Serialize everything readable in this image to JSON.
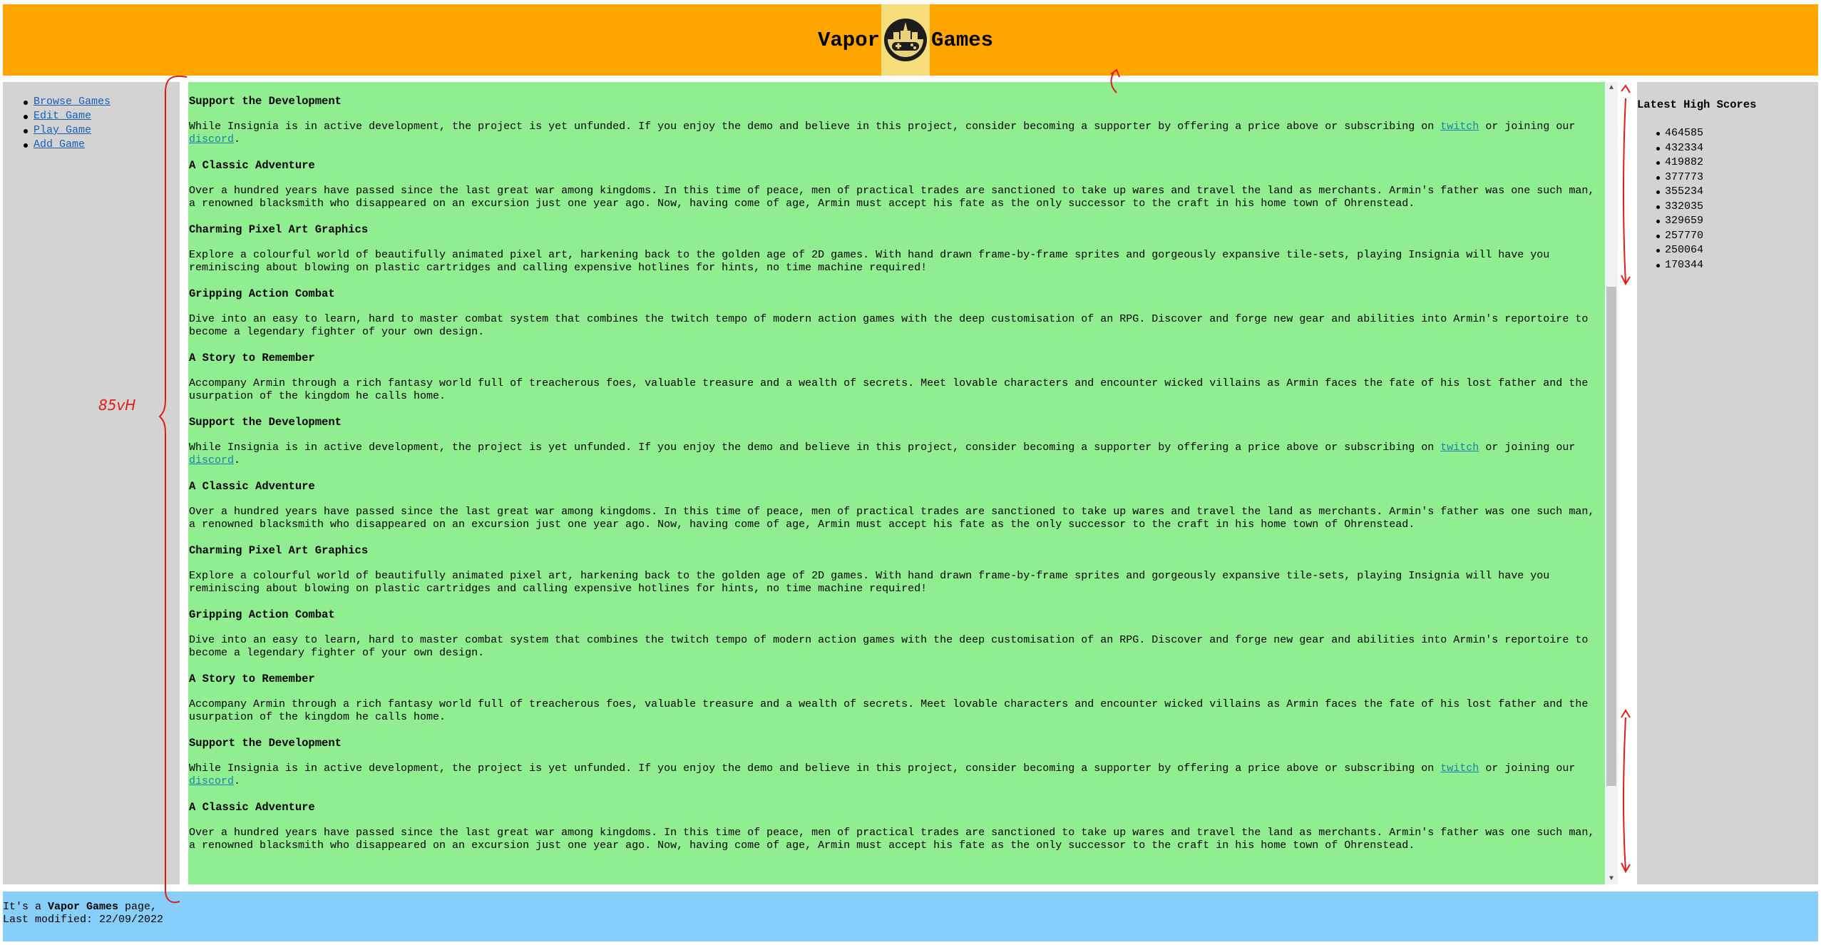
{
  "header": {
    "brand_left": "Vapor",
    "brand_right": "Games",
    "logo_icon": "gamepad-castle-logo-icon"
  },
  "nav": {
    "items": [
      {
        "label": "Browse Games"
      },
      {
        "label": "Edit Game"
      },
      {
        "label": "Play Game"
      },
      {
        "label": "Add Game"
      }
    ]
  },
  "main": {
    "sections": [
      {
        "title": "Support the Development",
        "text_before": "While Insignia is in active development, the project is yet unfunded. If you enjoy the demo and believe in this project, consider becoming a supporter by offering a price above or subscribing on ",
        "link1": "twitch",
        "text_mid": " or joining our ",
        "link2": "discord",
        "text_after": "."
      },
      {
        "title": "A Classic Adventure",
        "text": "Over a hundred years have passed since the last great war among kingdoms. In this time of peace, men of practical trades are sanctioned to take up wares and travel the land as merchants. Armin's father was one such man, a renowned blacksmith who disappeared on an excursion just one year ago. Now, having come of age, Armin must accept his fate as the only successor to the craft in his home town of Ohrenstead."
      },
      {
        "title": "Charming Pixel Art Graphics",
        "text": "Explore a colourful world of beautifully animated pixel art, harkening back to the golden age of 2D games. With hand drawn frame-by-frame sprites and gorgeously expansive tile-sets, playing Insignia will have you reminiscing about blowing on plastic cartridges and calling expensive hotlines for hints, no time machine required!"
      },
      {
        "title": "Gripping Action Combat",
        "text": "Dive into an easy to learn, hard to master combat system that combines the twitch tempo of modern action games with the deep customisation of an RPG. Discover and forge new gear and abilities into Armin's reportoire to become a legendary fighter of your own design."
      },
      {
        "title": "A Story to Remember",
        "text": "Accompany Armin through a rich fantasy world full of treacherous foes, valuable treasure and a wealth of secrets. Meet lovable characters and encounter wicked villains as Armin faces the fate of his lost father and the usurpation of the kingdom he calls home."
      },
      {
        "title": "Support the Development",
        "text_before": "While Insignia is in active development, the project is yet unfunded. If you enjoy the demo and believe in this project, consider becoming a supporter by offering a price above or subscribing on ",
        "link1": "twitch",
        "text_mid": " or joining our ",
        "link2": "discord",
        "text_after": "."
      },
      {
        "title": "A Classic Adventure",
        "text": "Over a hundred years have passed since the last great war among kingdoms. In this time of peace, men of practical trades are sanctioned to take up wares and travel the land as merchants. Armin's father was one such man, a renowned blacksmith who disappeared on an excursion just one year ago. Now, having come of age, Armin must accept his fate as the only successor to the craft in his home town of Ohrenstead."
      },
      {
        "title": "Charming Pixel Art Graphics",
        "text": "Explore a colourful world of beautifully animated pixel art, harkening back to the golden age of 2D games. With hand drawn frame-by-frame sprites and gorgeously expansive tile-sets, playing Insignia will have you reminiscing about blowing on plastic cartridges and calling expensive hotlines for hints, no time machine required!"
      },
      {
        "title": "Gripping Action Combat",
        "text": "Dive into an easy to learn, hard to master combat system that combines the twitch tempo of modern action games with the deep customisation of an RPG. Discover and forge new gear and abilities into Armin's reportoire to become a legendary fighter of your own design."
      },
      {
        "title": "A Story to Remember",
        "text": "Accompany Armin through a rich fantasy world full of treacherous foes, valuable treasure and a wealth of secrets. Meet lovable characters and encounter wicked villains as Armin faces the fate of his lost father and the usurpation of the kingdom he calls home."
      },
      {
        "title": "Support the Development",
        "text_before": "While Insignia is in active development, the project is yet unfunded. If you enjoy the demo and believe in this project, consider becoming a supporter by offering a price above or subscribing on ",
        "link1": "twitch",
        "text_mid": " or joining our ",
        "link2": "discord",
        "text_after": "."
      },
      {
        "title": "A Classic Adventure",
        "text": "Over a hundred years have passed since the last great war among kingdoms. In this time of peace, men of practical trades are sanctioned to take up wares and travel the land as merchants. Armin's father was one such man, a renowned blacksmith who disappeared on an excursion just one year ago. Now, having come of age, Armin must accept his fate as the only successor to the craft in his home town of Ohrenstead."
      }
    ]
  },
  "scores": {
    "title": "Latest High Scores",
    "items": [
      "464585",
      "432334",
      "419882",
      "377773",
      "355234",
      "332035",
      "329659",
      "257770",
      "250064",
      "170344"
    ]
  },
  "footer": {
    "line1_prefix": "It's a ",
    "line1_brand": "Vapor Games",
    "line1_suffix": " page,",
    "line2": "Last modified: 22/09/2022"
  },
  "annotation": {
    "label": "85vH",
    "color": "#e01b1b"
  },
  "colors": {
    "header": "#ffa500",
    "side": "#d3d3d3",
    "main": "#90ee90",
    "footer": "#87cefa",
    "link": "#1a5fb4"
  }
}
